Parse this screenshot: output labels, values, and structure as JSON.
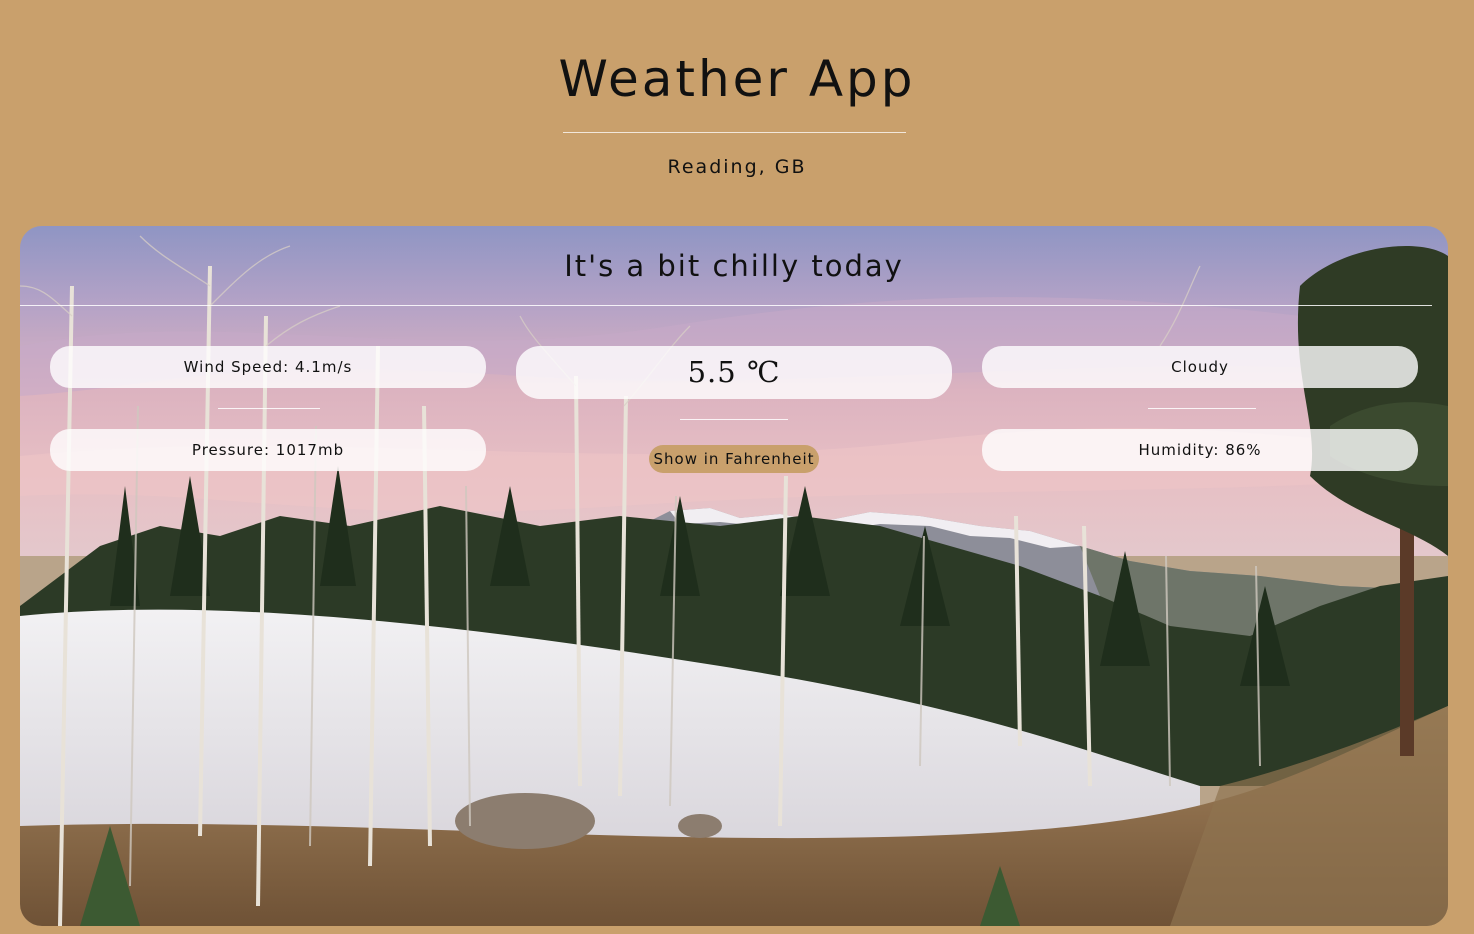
{
  "app": {
    "title": "Weather App",
    "location": "Reading, GB"
  },
  "panel": {
    "headline": "It's a bit chilly today",
    "wind_speed": "Wind Speed: 4.1m/s",
    "pressure": "Pressure: 1017mb",
    "temperature": "5.5 ℃",
    "condition": "Cloudy",
    "humidity": "Humidity: 86%",
    "unit_toggle_label": "Show in Fahrenheit"
  },
  "colors": {
    "page_background": "#c9a06c",
    "pill_background": "rgba(255,255,255,0.8)",
    "toggle_background": "#c9a06c"
  },
  "background_image": "winter-forest-mountain-landscape"
}
